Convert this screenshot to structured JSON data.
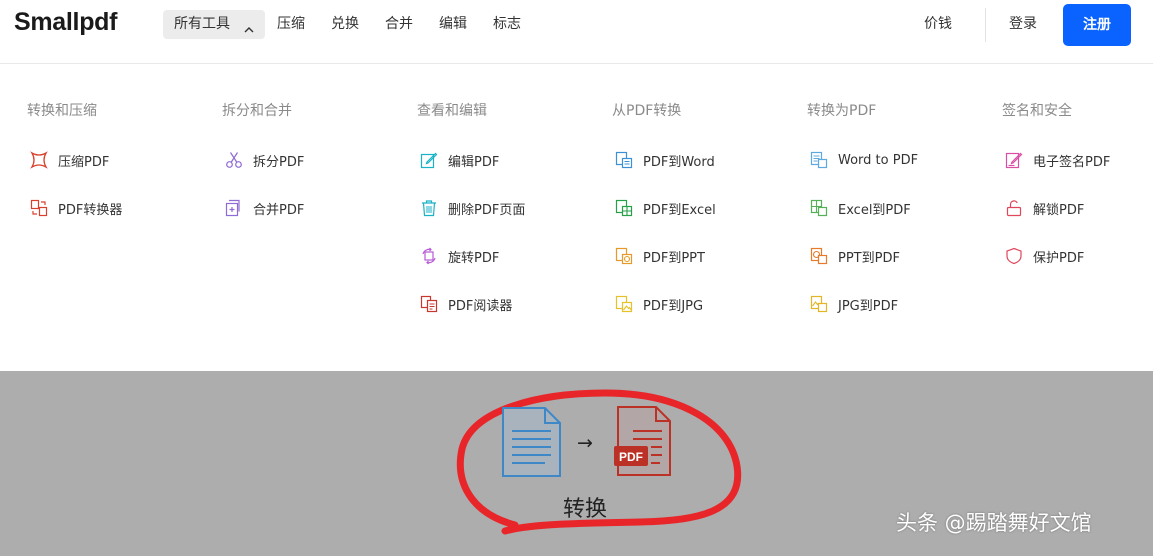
{
  "header": {
    "logo": "Smallpdf",
    "nav": [
      {
        "label": "所有工具"
      },
      {
        "label": "压缩"
      },
      {
        "label": "兑换"
      },
      {
        "label": "合并"
      },
      {
        "label": "编辑"
      },
      {
        "label": "标志"
      }
    ],
    "price": "价钱",
    "login": "登录",
    "register": "注册"
  },
  "menu": {
    "columns": [
      {
        "title": "转换和压缩",
        "items": [
          {
            "label": "压缩PDF",
            "icon": "compress-icon",
            "color": "#d9412e"
          },
          {
            "label": "PDF转换器",
            "icon": "converter-icon",
            "color": "#d9412e"
          }
        ]
      },
      {
        "title": "拆分和合并",
        "items": [
          {
            "label": "拆分PDF",
            "icon": "scissors-icon",
            "color": "#8f6bd6"
          },
          {
            "label": "合并PDF",
            "icon": "merge-icon",
            "color": "#8f6bd6"
          }
        ]
      },
      {
        "title": "查看和编辑",
        "items": [
          {
            "label": "编辑PDF",
            "icon": "edit-icon",
            "color": "#19b3c7"
          },
          {
            "label": "删除PDF页面",
            "icon": "trash-icon",
            "color": "#19b3c7"
          },
          {
            "label": "旋转PDF",
            "icon": "rotate-icon",
            "color": "#b75ad6"
          },
          {
            "label": "PDF阅读器",
            "icon": "reader-icon",
            "color": "#c8372e"
          }
        ]
      },
      {
        "title": "从PDF转换",
        "items": [
          {
            "label": "PDF到Word",
            "icon": "pdf-to-word-icon",
            "color": "#3d8fd6"
          },
          {
            "label": "PDF到Excel",
            "icon": "pdf-to-excel-icon",
            "color": "#27a049"
          },
          {
            "label": "PDF到PPT",
            "icon": "pdf-to-ppt-icon",
            "color": "#e79a2a"
          },
          {
            "label": "PDF到JPG",
            "icon": "pdf-to-jpg-icon",
            "color": "#e6c22a"
          }
        ]
      },
      {
        "title": "转换为PDF",
        "items": [
          {
            "label": "Word to PDF",
            "icon": "word-to-pdf-icon",
            "color": "#5da9e0"
          },
          {
            "label": "Excel到PDF",
            "icon": "excel-to-pdf-icon",
            "color": "#55b057"
          },
          {
            "label": "PPT到PDF",
            "icon": "ppt-to-pdf-icon",
            "color": "#e57b2b"
          },
          {
            "label": "JPG到PDF",
            "icon": "jpg-to-pdf-icon",
            "color": "#e4b526"
          }
        ]
      },
      {
        "title": "签名和安全",
        "items": [
          {
            "label": "电子签名PDF",
            "icon": "esign-icon",
            "color": "#d94fa4"
          },
          {
            "label": "解锁PDF",
            "icon": "unlock-icon",
            "color": "#e0475c"
          },
          {
            "label": "保护PDF",
            "icon": "shield-icon",
            "color": "#e0475c"
          }
        ]
      }
    ]
  },
  "hero": {
    "pdf_badge": "PDF",
    "arrow": "→",
    "label": "转换",
    "highlight_color": "#e8262a"
  },
  "watermark": "头条 @踢踏舞好文馆"
}
